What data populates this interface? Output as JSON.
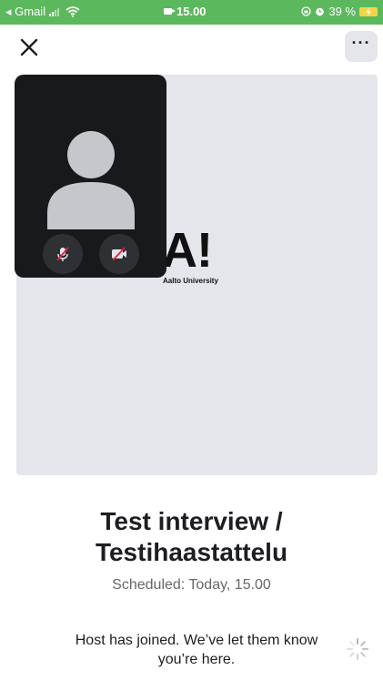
{
  "status_bar": {
    "back_app": "◂ Gmail",
    "time": "15.00",
    "battery": "39 %"
  },
  "top_bar": {
    "close_icon": "close-icon",
    "more_label": "···"
  },
  "video": {
    "logo_mark": "A!",
    "logo_text": "Aalto University",
    "self_view": {
      "mic_state": "muted",
      "camera_state": "off"
    }
  },
  "meeting": {
    "title_line1": "Test interview /",
    "title_line2": "Testihaastattelu",
    "scheduled": "Scheduled: Today, 15.00",
    "status_line1": "Host has joined. We’ve let them know",
    "status_line2": "you’re here."
  },
  "colors": {
    "status_bar": "#5cb85c",
    "video_bg": "#e4e6eb",
    "self_view_bg": "#18191b"
  }
}
